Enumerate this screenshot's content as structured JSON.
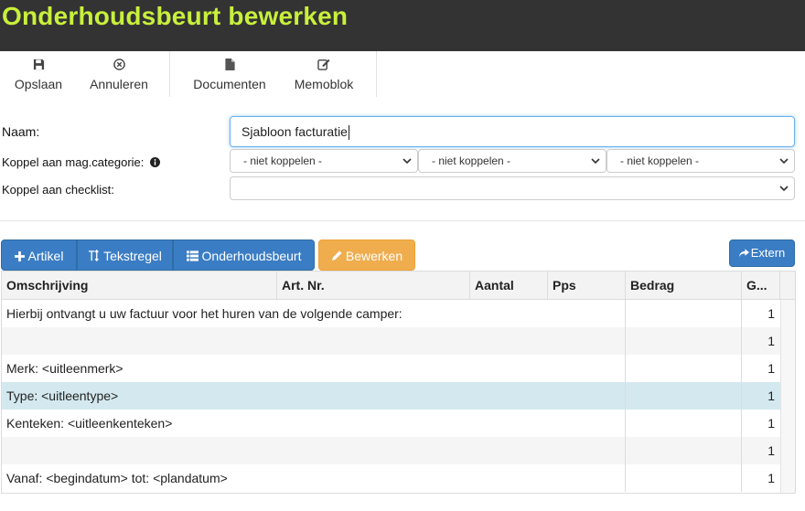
{
  "window": {
    "title": "Onderhoudsbeurt bewerken"
  },
  "toolbar": {
    "save": "Opslaan",
    "cancel": "Annuleren",
    "documents": "Documenten",
    "memo": "Memoblok"
  },
  "form": {
    "name_label": "Naam:",
    "name_value": "Sjabloon facturatie",
    "category_label": "Koppel aan mag.categorie:",
    "category_selects": [
      "- niet koppelen -",
      "- niet koppelen -",
      "- niet koppelen -"
    ],
    "checklist_label": "Koppel aan checklist:",
    "checklist_value": ""
  },
  "actions": {
    "artikel": "Artikel",
    "tekstregel": "Tekstregel",
    "onderhoudsbeurt": "Onderhoudsbeurt",
    "bewerken": "Bewerken",
    "extern": "Extern"
  },
  "grid": {
    "columns": [
      "Omschrijving",
      "Art. Nr.",
      "Aantal",
      "Pps",
      "Bedrag",
      "G..."
    ],
    "rows": [
      {
        "desc": "Hierbij ontvangt u uw factuur voor het huren van de volgende camper:",
        "g": "1"
      },
      {
        "desc": "",
        "g": "1"
      },
      {
        "desc": "Merk: <uitleenmerk>",
        "g": "1"
      },
      {
        "desc": "Type: <uitleentype>",
        "g": "1"
      },
      {
        "desc": "Kenteken: <uitleenkenteken>",
        "g": "1"
      },
      {
        "desc": "",
        "g": "1"
      },
      {
        "desc": "Vanaf: <begindatum> tot: <plandatum>",
        "g": "1"
      }
    ]
  },
  "colors": {
    "title_bg": "#333333",
    "title_fg": "#c8f03c",
    "primary": "#3b7dc4",
    "warning": "#f0ad4e",
    "row_selected": "#d4e9ef",
    "row_alt": "#f5f5f5"
  },
  "icons": {
    "save": "floppy-icon",
    "cancel": "circle-x-icon",
    "documents": "document-icon",
    "memo": "edit-icon",
    "info": "info-icon",
    "plus": "plus-icon",
    "text": "text-height-icon",
    "list": "list-icon",
    "pencil": "pencil-icon",
    "share": "share-icon"
  }
}
